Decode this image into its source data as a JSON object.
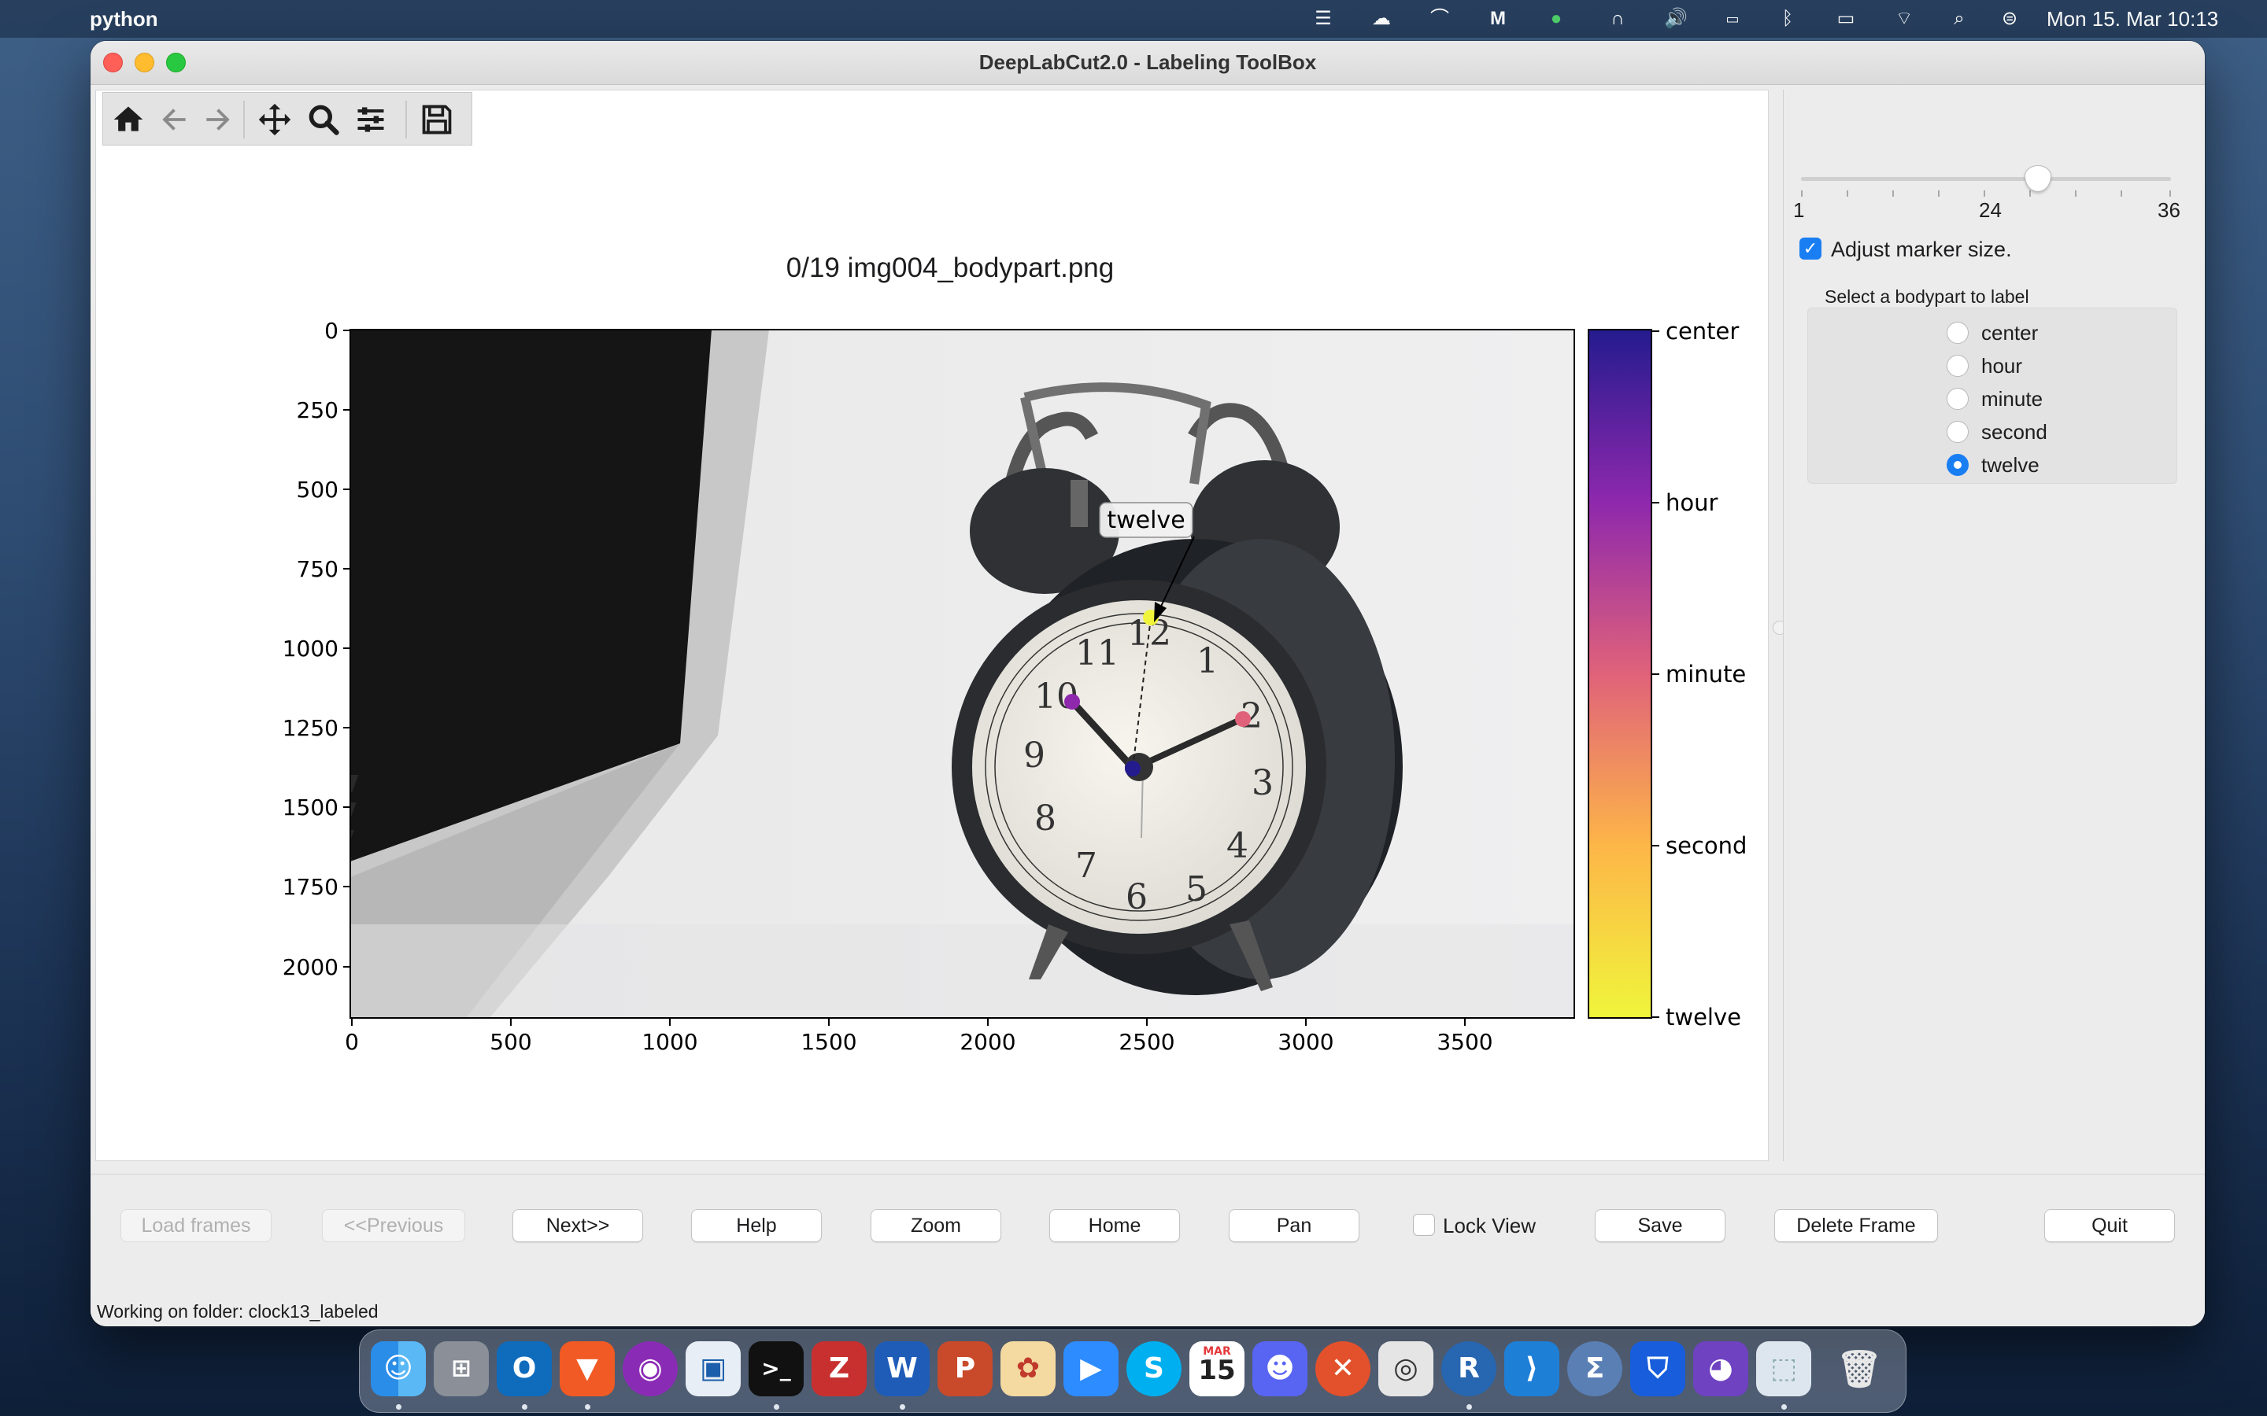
{
  "menubar": {
    "app_name": "python",
    "clock": "Mon 15. Mar  10:13"
  },
  "window": {
    "title": "DeepLabCut2.0 - Labeling ToolBox"
  },
  "plot": {
    "title": "0/19 img004_bodypart.png",
    "y_ticks": [
      "0",
      "250",
      "500",
      "750",
      "1000",
      "1250",
      "1500",
      "1750",
      "2000"
    ],
    "x_ticks": [
      "0",
      "500",
      "1000",
      "1500",
      "2000",
      "2500",
      "3000",
      "3500"
    ],
    "colorbar_labels": [
      "center",
      "hour",
      "minute",
      "second",
      "twelve"
    ],
    "annotation": "twelve",
    "colormap": [
      "#241b8e",
      "#8e28ad",
      "#e0627a",
      "#fdb648",
      "#f0f53b"
    ]
  },
  "sidebar": {
    "slider_min": "1",
    "slider_mid": "24",
    "slider_max": "36",
    "adjust_label": "Adjust marker size.",
    "group_title": "Select a bodypart to label",
    "bodyparts": [
      "center",
      "hour",
      "minute",
      "second",
      "twelve"
    ],
    "selected": "twelve"
  },
  "buttons": {
    "load": "Load frames",
    "previous": "<<Previous",
    "next": "Next>>",
    "help": "Help",
    "zoom": "Zoom",
    "home": "Home",
    "pan": "Pan",
    "lock_view": "Lock View",
    "save": "Save",
    "delete": "Delete Frame",
    "quit": "Quit"
  },
  "status": "Working on folder: clock13_labeled",
  "dock": {
    "calendar_month": "MAR",
    "calendar_day": "15"
  }
}
